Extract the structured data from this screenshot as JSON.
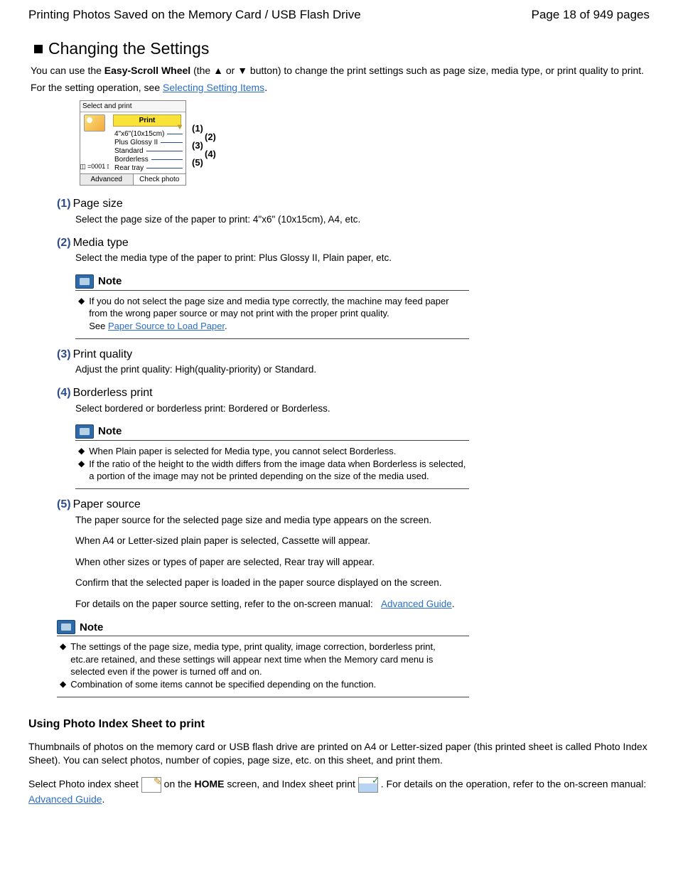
{
  "header": {
    "title": "Printing Photos Saved on the Memory Card / USB Flash Drive",
    "page_label": "Page 18 of 949 pages"
  },
  "section": {
    "title": "Changing the Settings",
    "intro_1a": "You can use the ",
    "intro_bold": "Easy-Scroll Wheel",
    "intro_1b": " (the ",
    "intro_1c": " or ",
    "intro_1d": " button) to change the print settings such as page size, media type, or print quality to print.",
    "intro_2a": "For the setting operation, see ",
    "intro_link": "Selecting Setting Items",
    "period": "."
  },
  "pane": {
    "title": "Select and print",
    "print_btn": "Print",
    "opts": [
      "4\"x6\"(10x15cm)",
      "Plus Glossy II",
      "Standard",
      "Borderless",
      "Rear tray"
    ],
    "count": "=0001",
    "foot_left": "Advanced",
    "foot_right": "Check photo",
    "callouts": [
      "(1)",
      "(2)",
      "(3)",
      "(4)",
      "(5)"
    ]
  },
  "items": [
    {
      "num": "(1)",
      "title": "Page size",
      "desc": "Select the page size of the paper to print: 4\"x6\" (10x15cm), A4, etc."
    },
    {
      "num": "(2)",
      "title": "Media type",
      "desc": "Select the media type of the paper to print: Plus Glossy II, Plain paper, etc."
    },
    {
      "num": "(3)",
      "title": "Print quality",
      "desc": "Adjust the print quality: High(quality-priority) or Standard."
    },
    {
      "num": "(4)",
      "title": "Borderless print",
      "desc": "Select bordered or borderless print: Bordered or Borderless."
    }
  ],
  "item5": {
    "num": "(5)",
    "title": "Paper source",
    "p1": "The paper source for the selected page size and media type appears on the screen.",
    "p2": "When A4 or Letter-sized plain paper is selected, Cassette will appear.",
    "p3": "When other sizes or types of paper are selected, Rear tray will appear.",
    "p4": "Confirm that the selected paper is loaded in the paper source displayed on the screen.",
    "p5a": "For details on the paper source setting, refer to the on-screen manual: ",
    "p5_link": "Advanced Guide"
  },
  "note_title": "Note",
  "note1": {
    "l1": "If you do not select the page size and media type correctly, the machine may feed paper from the wrong paper source or may not print with the proper print quality.",
    "see": "See ",
    "link": "Paper Source to Load Paper"
  },
  "note2": {
    "l1": "When Plain paper is selected for Media type, you cannot select Borderless.",
    "l2": "If the ratio of the height to the width differs from the image data when Borderless is selected, a portion of the image may not be printed depending on the size of the media used."
  },
  "note3": {
    "l1": "The settings of the page size, media type, print quality, image correction, borderless print, etc.are retained, and these settings will appear next time when the Memory card menu is selected even if the power is turned off and on.",
    "l2": "Combination of some items cannot be specified depending on the function."
  },
  "photo_index": {
    "h": "Using Photo Index Sheet to print",
    "p1": "Thumbnails of photos on the memory card or USB flash drive are printed on A4 or Letter-sized paper (this printed sheet is called Photo Index Sheet). You can select photos, number of copies, page size, etc. on this sheet, and print them.",
    "p2a": "Select Photo index sheet ",
    "p2b": " on the ",
    "p2_bold": "HOME",
    "p2c": " screen, and Index sheet print ",
    "p2d": ". For details on the operation, refer to the on-screen manual: ",
    "link": "Advanced Guide"
  }
}
